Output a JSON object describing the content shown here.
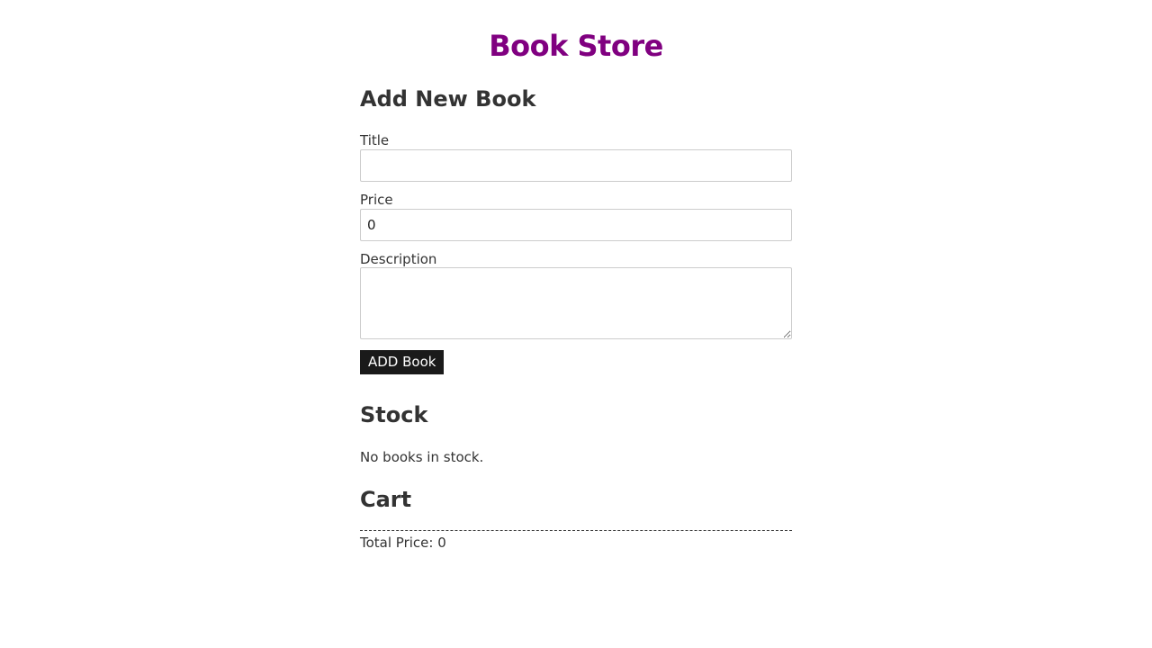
{
  "app": {
    "title": "Book Store"
  },
  "add_book": {
    "heading": "Add New Book",
    "title_label": "Title",
    "title_value": "",
    "price_label": "Price",
    "price_value": "0",
    "description_label": "Description",
    "description_value": "",
    "submit_label": "ADD Book"
  },
  "stock": {
    "heading": "Stock",
    "empty_message": "No books in stock."
  },
  "cart": {
    "heading": "Cart",
    "total_label": "Total Price: 0"
  },
  "colors": {
    "title": "#800080",
    "button_bg": "#1a1a1a",
    "text": "#333333"
  }
}
